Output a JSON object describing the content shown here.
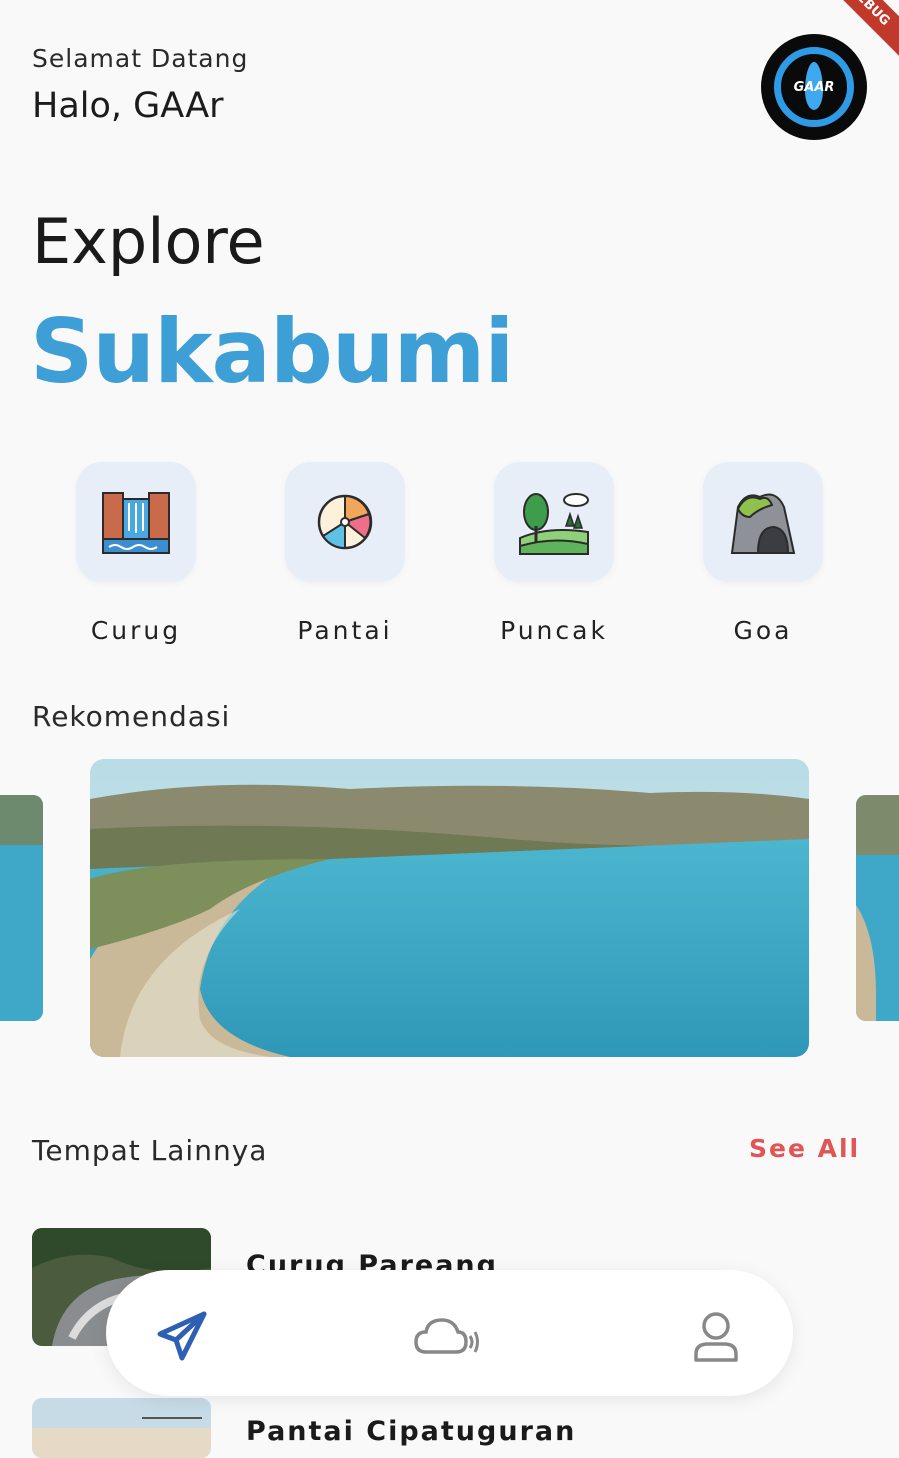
{
  "header": {
    "greeting": "Selamat Datang",
    "hello": "Halo, GAAr",
    "avatar_text": "GAAR",
    "debug_banner": "DEBUG"
  },
  "hero": {
    "explore": "Explore",
    "city": "Sukabumi"
  },
  "categories": [
    {
      "label": "Curug",
      "icon": "waterfall-icon"
    },
    {
      "label": "Pantai",
      "icon": "beach-ball-icon"
    },
    {
      "label": "Puncak",
      "icon": "mountain-landscape-icon"
    },
    {
      "label": "Goa",
      "icon": "cave-icon"
    }
  ],
  "recommendation": {
    "title": "Rekomendasi"
  },
  "others": {
    "title": "Tempat Lainnya",
    "see_all": "See All",
    "items": [
      {
        "name": "Curug Pareang"
      },
      {
        "name": "Pantai Cipatuguran"
      }
    ]
  },
  "nav": {
    "items": [
      "send-icon",
      "weather-cloud-icon",
      "profile-icon"
    ],
    "active_color": "#2f5fb3",
    "inactive_color": "#888888"
  },
  "colors": {
    "accent": "#3d9fd6",
    "see_all": "#e05656",
    "tile_bg": "#e7eef8"
  }
}
